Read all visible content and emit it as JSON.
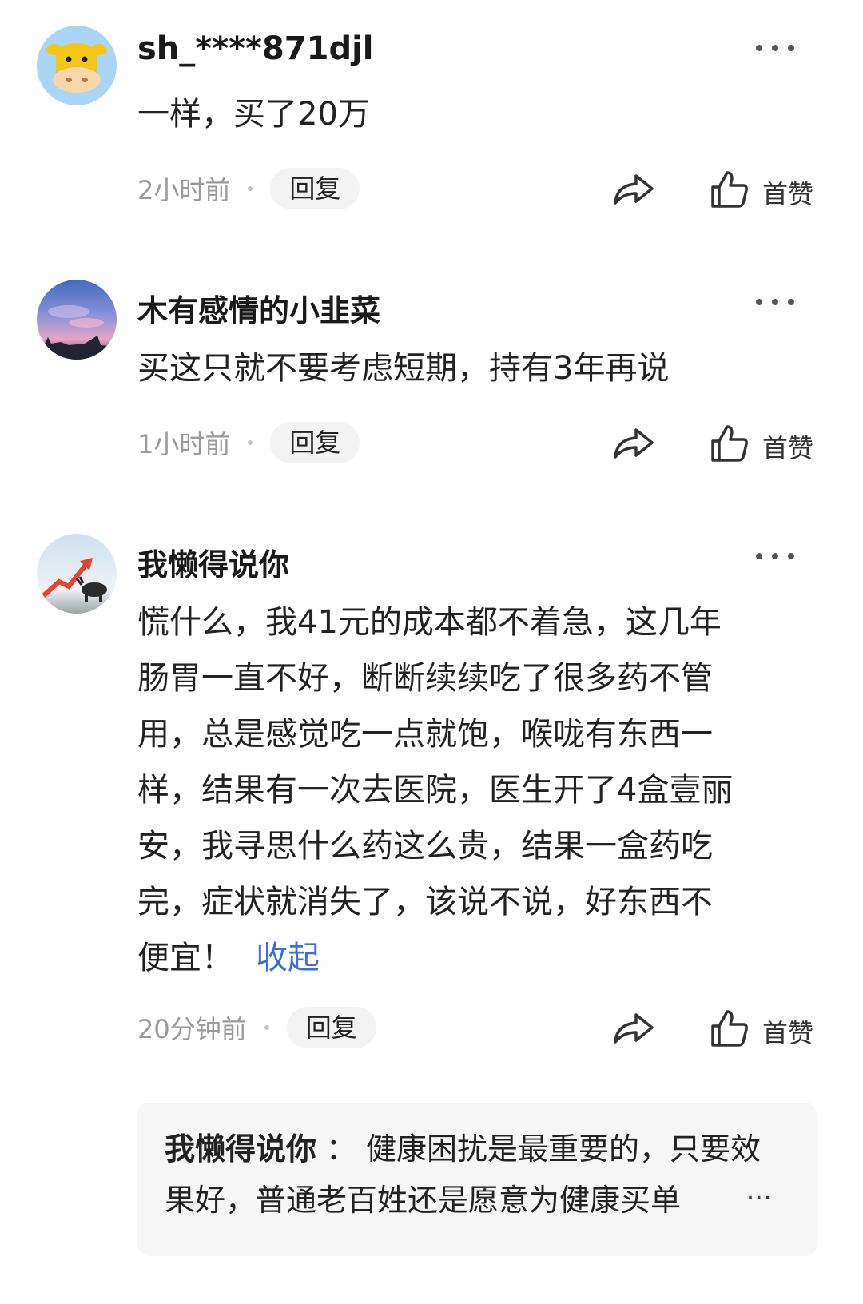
{
  "comments": [
    {
      "username": "sh_****871djl",
      "content": "一样，买了20万",
      "time": "2小时前",
      "reply_label": "回复",
      "like_label": "首赞"
    },
    {
      "username": "木有感情的小韭菜",
      "content": "买这只就不要考虑短期，持有3年再说",
      "time": "1小时前",
      "reply_label": "回复",
      "like_label": "首赞"
    },
    {
      "username": "我懒得说你",
      "content_lines": [
        "慌什么，我41元的成本都不着急，这几年",
        "肠胃一直不好，断断续续吃了很多药不管",
        "用，总是感觉吃一点就饱，喉咙有东西一",
        "样，结果有一次去医院，医生开了4盒壹丽",
        "安，我寻思什么药这么贵，结果一盒药吃",
        "完，症状就消失了，该说不说，好东西不",
        "便宜！"
      ],
      "collapse_label": "收起",
      "time": "20分钟前",
      "reply_label": "回复",
      "like_label": "首赞",
      "sub_reply": {
        "author": "我懒得说你",
        "separator": "：",
        "text": "健康困扰是最重要的，只要效果好，普通老百姓还是愿意为健康买单",
        "ellipsis": "..."
      }
    }
  ],
  "icons": {
    "avatar_1": "cartoon-cow-avatar",
    "avatar_2": "sky-scenery-avatar",
    "avatar_3": "bull-stock-chart-avatar",
    "more": "more-dots-icon",
    "share": "share-arrow-icon",
    "like": "thumbs-up-icon"
  },
  "colors": {
    "link": "#3a6fd8",
    "muted": "#9a9a9a",
    "reply_bg": "#f3f3f3",
    "avatar_1_bg": "#a8d6f4"
  }
}
